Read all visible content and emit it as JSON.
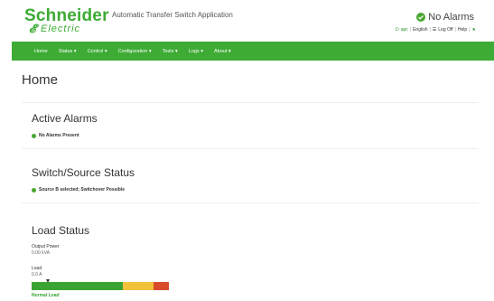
{
  "brand": {
    "name_top": "Schneider",
    "name_bottom": "Electric"
  },
  "header": {
    "app_title": "Automatic Transfer Switch Application",
    "alarm_status": "No Alarms"
  },
  "util_links": {
    "apc": "apc",
    "language": "English",
    "logoff": "Log Off",
    "help": "Help"
  },
  "nav": {
    "items": [
      {
        "label": "Home"
      },
      {
        "label": "Status ▾"
      },
      {
        "label": "Control ▾"
      },
      {
        "label": "Configuration ▾"
      },
      {
        "label": "Tests ▾"
      },
      {
        "label": "Logs ▾"
      },
      {
        "label": "About ▾"
      }
    ]
  },
  "page": {
    "title": "Home"
  },
  "active_alarms": {
    "title": "Active Alarms",
    "status": "No Alarms Present"
  },
  "switch_source": {
    "title": "Switch/Source Status",
    "status": "Source B selected; Switchover Possible"
  },
  "load_status": {
    "title": "Load Status",
    "output_power_label": "Output Power",
    "output_power_value": "0.00 kVA",
    "load_label": "Load",
    "load_value": "0.0 A",
    "load_state": "Normal Load"
  },
  "colors": {
    "brand_green": "#3dab34",
    "status_green": "#4ca734",
    "warning_yellow": "#f2c23a",
    "alarm_red": "#d74a2a"
  },
  "icons": {
    "alarm": "check-circle-icon",
    "apc": "power-icon",
    "logoff": "logoff-icon",
    "help": "pin-icon"
  }
}
